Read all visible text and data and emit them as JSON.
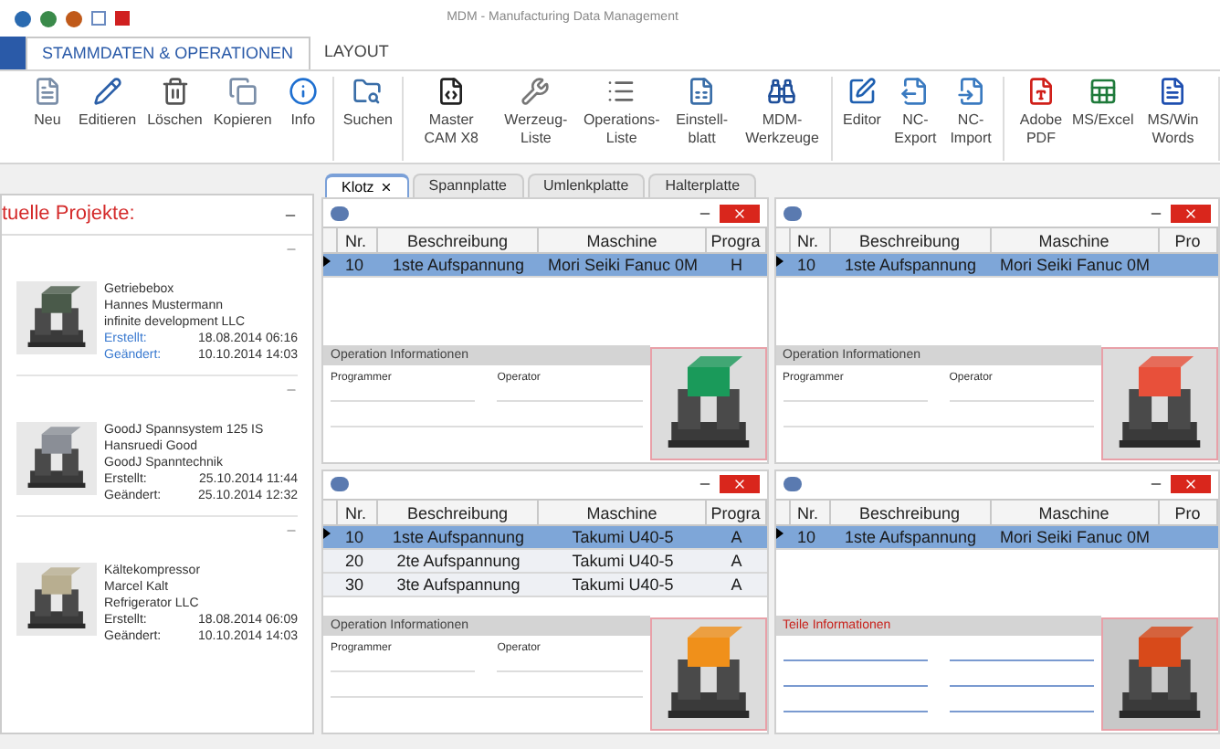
{
  "window": {
    "title": "MDM - Manufacturing Data Management"
  },
  "ribbon_tabs": [
    {
      "label": "STAMMDATEN & OPERATIONEN",
      "selected": true
    },
    {
      "label": "LAYOUT",
      "selected": false
    }
  ],
  "ribbon_groups": [
    {
      "buttons": [
        {
          "label": "Neu"
        },
        {
          "label": "Editieren"
        },
        {
          "label": "Löschen"
        },
        {
          "label": "Kopieren"
        },
        {
          "label": "Info"
        }
      ]
    },
    {
      "buttons": [
        {
          "label": "Suchen"
        }
      ]
    },
    {
      "buttons": [
        {
          "label": "Master CAM X8"
        },
        {
          "label": "Werzeug-Liste"
        },
        {
          "label": "Operations-Liste"
        },
        {
          "label": "Einstell-blatt"
        },
        {
          "label": "MDM-Werkzeuge"
        }
      ]
    },
    {
      "buttons": [
        {
          "label": "Editor"
        },
        {
          "label": "NC-Export"
        },
        {
          "label": "NC-Import"
        }
      ]
    },
    {
      "buttons": [
        {
          "label": "Adobe PDF"
        },
        {
          "label": "MS/Excel"
        },
        {
          "label": "MS/Win Words"
        }
      ]
    }
  ],
  "document_tabs": [
    {
      "label": "Klotz",
      "selected": true
    },
    {
      "label": "Spannplatte",
      "selected": false
    },
    {
      "label": "Umlenkplatte",
      "selected": false
    },
    {
      "label": "Halterplatte",
      "selected": false
    }
  ],
  "projects": {
    "title": "tuelle Projekte:",
    "items": [
      {
        "name": "Getriebebox",
        "person": "Hannes Mustermann",
        "company": "infinite development LLC",
        "created_label": "Erstellt:",
        "created": "18.08.2014 06:16",
        "changed_label": "Geändert:",
        "changed": "10.10.2014 14:03",
        "selected": true,
        "color": "#4a5a4a"
      },
      {
        "name": "GoodJ Spannsystem 125 IS",
        "person": "Hansruedi Good",
        "company": "GoodJ Spanntechnik",
        "created_label": "Erstellt:",
        "created": "25.10.2014 11:44",
        "changed_label": "Geändert:",
        "changed": "25.10.2014 12:32",
        "selected": false,
        "color": "#8a8e96"
      },
      {
        "name": "Kältekompressor",
        "person": "Marcel Kalt",
        "company": "Refrigerator LLC",
        "created_label": "Erstellt:",
        "created": "18.08.2014 06:09",
        "changed_label": "Geändert:",
        "changed": "10.10.2014 14:03",
        "selected": false,
        "color": "#b8ae90"
      }
    ]
  },
  "panels": [
    {
      "columns": [
        "Nr.",
        "Beschreibung",
        "Maschine",
        "Progra"
      ],
      "rows": [
        {
          "cells": [
            "10",
            "1ste Aufspannung",
            "Mori Seiki Fanuc 0M",
            "H"
          ],
          "selected": true
        }
      ],
      "info": {
        "kind": "operation",
        "title": "Operation Informationen",
        "fields": [
          "Programmer",
          "Operator"
        ]
      },
      "color": "#1a9a5a"
    },
    {
      "columns": [
        "Nr.",
        "Beschreibung",
        "Maschine",
        "Pro"
      ],
      "rows": [
        {
          "cells": [
            "10",
            "1ste Aufspannung",
            "Mori Seiki Fanuc 0M"
          ],
          "selected": true
        }
      ],
      "info": {
        "kind": "operation",
        "title": "Operation Informationen",
        "fields": [
          "Programmer",
          "Operator"
        ]
      },
      "color": "#e8503a"
    },
    {
      "columns": [
        "Nr.",
        "Beschreibung",
        "Maschine",
        "Progra"
      ],
      "rows": [
        {
          "cells": [
            "10",
            "1ste Aufspannung",
            "Takumi U40-5",
            "A"
          ],
          "selected": true
        },
        {
          "cells": [
            "20",
            "2te Aufspannung",
            "Takumi U40-5",
            "A"
          ],
          "selected": false
        },
        {
          "cells": [
            "30",
            "3te Aufspannung",
            "Takumi U40-5",
            "A"
          ],
          "selected": false
        }
      ],
      "info": {
        "kind": "operation",
        "title": "Operation Informationen",
        "fields": [
          "Programmer",
          "Operator"
        ]
      },
      "color": "#f0901a"
    },
    {
      "columns": [
        "Nr.",
        "Beschreibung",
        "Maschine",
        "Pro"
      ],
      "rows": [
        {
          "cells": [
            "10",
            "1ste Aufspannung",
            "Mori Seiki Fanuc 0M"
          ],
          "selected": true
        }
      ],
      "info": {
        "kind": "part",
        "title": "Teile Informationen"
      },
      "color": "#d84a1a"
    }
  ]
}
